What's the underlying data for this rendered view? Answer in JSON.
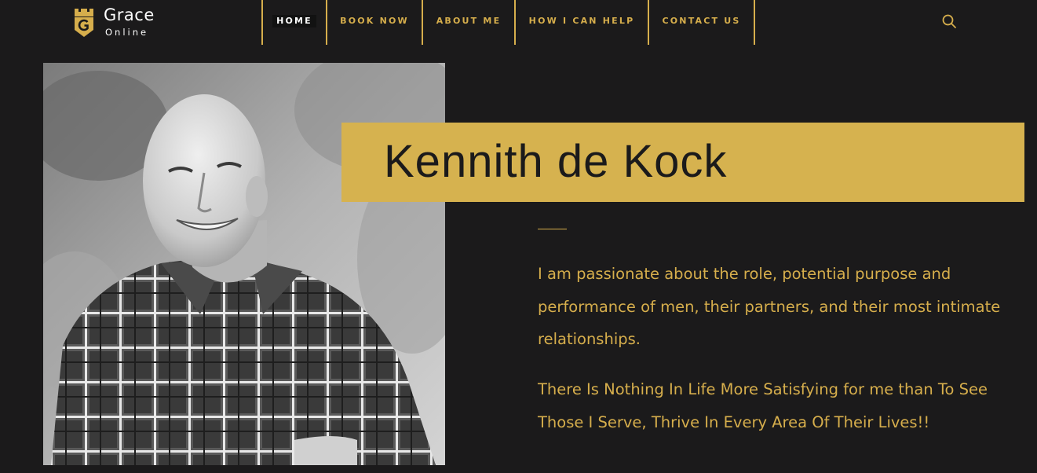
{
  "logo": {
    "name": "Grace",
    "subtitle": "Online",
    "icon": "castle-g-icon"
  },
  "nav": {
    "items": [
      {
        "label": "HOME",
        "active": true
      },
      {
        "label": "BOOK NOW",
        "active": false
      },
      {
        "label": "ABOUT ME",
        "active": false
      },
      {
        "label": "HOW I CAN HELP",
        "active": false
      },
      {
        "label": "CONTACT US",
        "active": false
      }
    ],
    "search_icon": "search-icon"
  },
  "profile": {
    "name": "Kennith de Kock",
    "paragraphs": [
      "I am passionate about the role, potential purpose and performance of men, their partners, and their most intimate relationships.",
      "There Is Nothing In Life More Satisfying for me than To See Those I Serve, Thrive In Every Area Of Their Lives!!"
    ]
  },
  "colors": {
    "background": "#1b1a1b",
    "accent": "#d6ae4c",
    "banner": "#d6b24f"
  }
}
